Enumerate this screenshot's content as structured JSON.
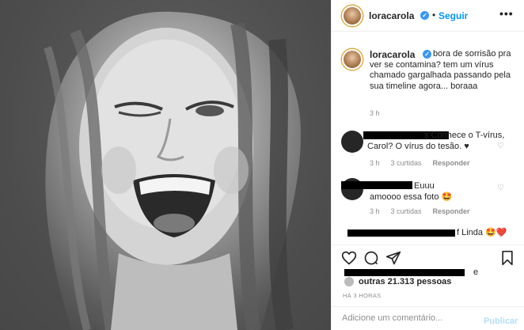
{
  "post": {
    "username": "loracarola",
    "follow_label": "Seguir",
    "separator": "•",
    "more_label": "•••",
    "caption": "bora de sorrisão pra ver se contamina? tem um vírus chamado gargalhada passando pela sua timeline agora... boraaa",
    "caption_time": "3 h"
  },
  "comments": [
    {
      "text": "s Conhece o T-vírus, Carol? O vírus do tesão. ♥",
      "time": "3 h",
      "likes": "3 curtidas",
      "reply": "Responder"
    },
    {
      "text": "Euuu amoooo essa foto 🤩",
      "time": "3 h",
      "likes": "3 curtidas",
      "reply": "Responder"
    },
    {
      "text": "f Linda 🤩❤️"
    }
  ],
  "likes": {
    "suffix": "e",
    "text": "outras 21.313 pessoas"
  },
  "posted_ago": "HÁ 3 HORAS",
  "comment_box": {
    "placeholder": "Adicione um comentário...",
    "publish_label": "Publicar"
  },
  "colors": {
    "link": "#0095f6",
    "muted": "#8e8e8e",
    "publish_disabled": "#b2dffc",
    "verified": "#3897f0"
  },
  "icons": [
    "verified-badge-icon",
    "more-options-icon",
    "heart-icon",
    "comment-icon",
    "share-icon",
    "bookmark-icon"
  ]
}
